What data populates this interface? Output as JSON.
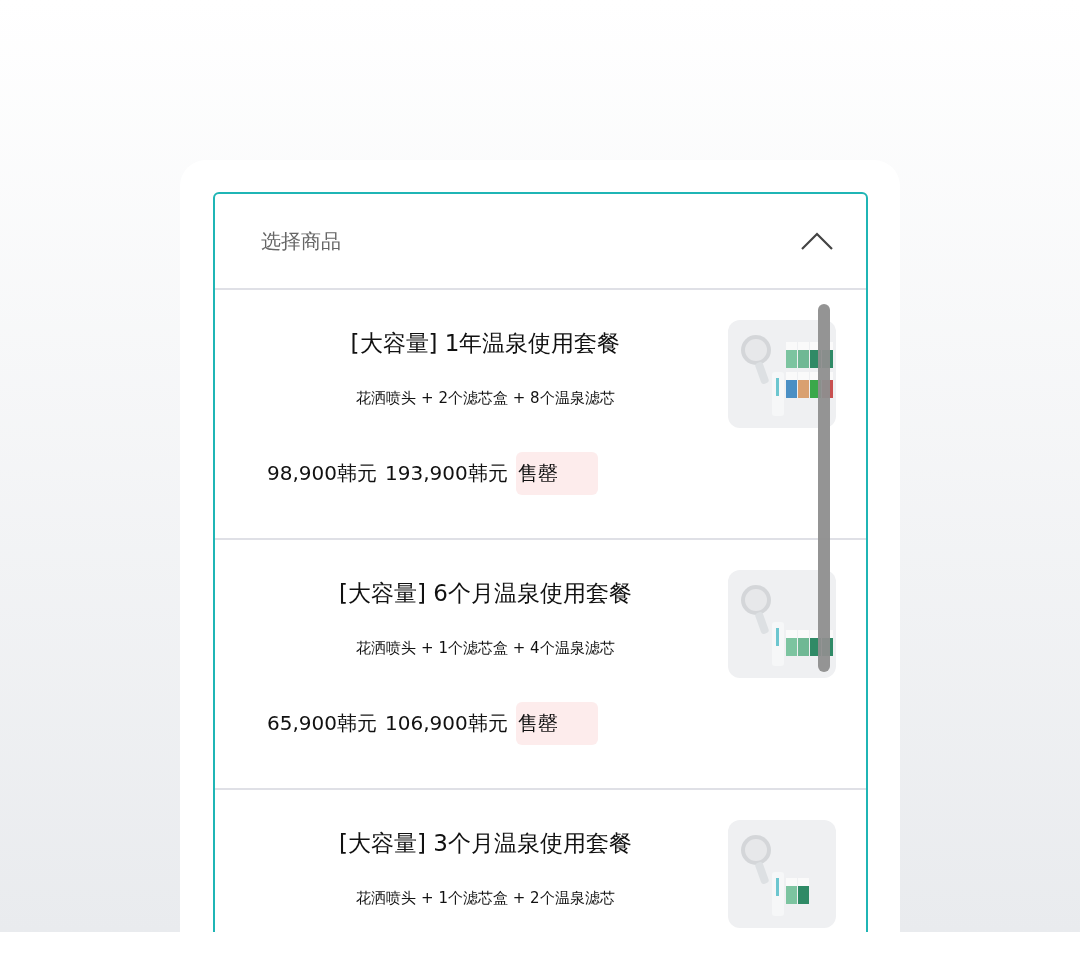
{
  "dropdown": {
    "label": "选择商品",
    "expanded": true
  },
  "products": [
    {
      "title": "[大容量] 1年温泉使用套餐",
      "contents": "花洒喷头 + 2个滤芯盒 + 8个温泉滤芯",
      "price": "98,900韩元",
      "original_price": "193,900韩元",
      "status": "售罄"
    },
    {
      "title": "[大容量] 6个月温泉使用套餐",
      "contents": "花洒喷头 + 1个滤芯盒 + 4个温泉滤芯",
      "price": "65,900韩元",
      "original_price": "106,900韩元",
      "status": "售罄"
    },
    {
      "title": "[大容量] 3个月温泉使用套餐",
      "contents": "花洒喷头 + 1个滤芯盒 + 2个温泉滤芯"
    }
  ]
}
